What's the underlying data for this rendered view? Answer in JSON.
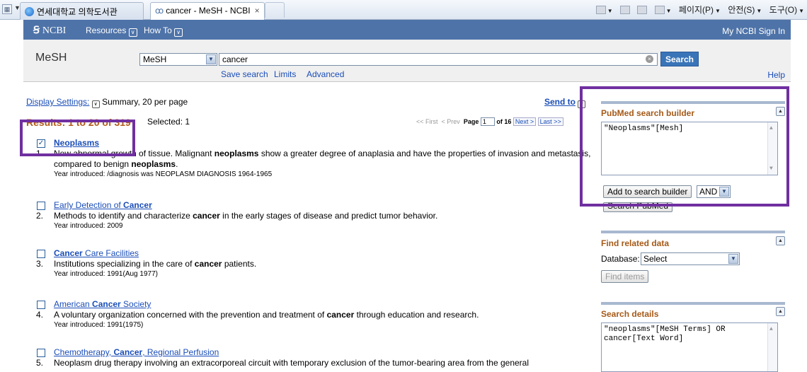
{
  "browser": {
    "tabs": [
      {
        "label": "연세대학교 의학도서관"
      },
      {
        "label": "cancer - MeSH - NCBI",
        "close": "×"
      }
    ],
    "commands": [
      "페이지(P)",
      "안전(S)",
      "도구(O)"
    ]
  },
  "ncbi": {
    "logo": "NCBI",
    "nav": [
      "Resources",
      "How To"
    ],
    "user_links": "My NCBI  Sign In"
  },
  "search": {
    "db_title": "MeSH",
    "db_select": "MeSH",
    "query": "cancer",
    "button": "Search",
    "links": [
      "Save search",
      "Limits",
      "Advanced"
    ],
    "help": "Help"
  },
  "results": {
    "display_settings_label": "Display Settings:",
    "display_settings_value": "Summary, 20 per page",
    "send_to": "Send to",
    "count_text": "Results: 1 to 20 of 319",
    "selected": "Selected: 1",
    "pager": {
      "first": "<< First",
      "prev": "< Prev",
      "page_label": "Page",
      "page": "1",
      "of": "of 16",
      "next": "Next >",
      "last": "Last >>"
    },
    "items": [
      {
        "checked": true,
        "number": "1.",
        "title_parts": [
          {
            "t": "Neoplasms",
            "b": true
          }
        ],
        "desc_parts": [
          {
            "t": "New abnormal growth of tissue. Malignant "
          },
          {
            "t": "neoplasms",
            "b": true
          },
          {
            "t": " show a greater degree of anaplasia and have the properties of invasion and metastasis, compared to benign "
          },
          {
            "t": "neoplasms",
            "b": true
          },
          {
            "t": "."
          }
        ],
        "year": "Year introduced: /diagnosis was NEOPLASM DIAGNOSIS 1964-1965"
      },
      {
        "checked": false,
        "number": "2.",
        "title_parts": [
          {
            "t": "Early Detection of "
          },
          {
            "t": "Cancer",
            "b": true
          }
        ],
        "desc_parts": [
          {
            "t": "Methods to identify and characterize "
          },
          {
            "t": "cancer",
            "b": true
          },
          {
            "t": " in the early stages of disease and predict tumor behavior."
          }
        ],
        "year": "Year introduced: 2009"
      },
      {
        "checked": false,
        "number": "3.",
        "title_parts": [
          {
            "t": "Cancer",
            "b": true
          },
          {
            "t": " Care Facilities"
          }
        ],
        "desc_parts": [
          {
            "t": "Institutions specializing in the care of "
          },
          {
            "t": "cancer",
            "b": true
          },
          {
            "t": " patients."
          }
        ],
        "year": "Year introduced: 1991(Aug 1977)"
      },
      {
        "checked": false,
        "number": "4.",
        "title_parts": [
          {
            "t": "American "
          },
          {
            "t": "Cancer",
            "b": true
          },
          {
            "t": " Society"
          }
        ],
        "desc_parts": [
          {
            "t": "A voluntary organization concerned with the prevention and treatment of "
          },
          {
            "t": "cancer",
            "b": true
          },
          {
            "t": " through education and research."
          }
        ],
        "year": "Year introduced: 1991(1975)"
      },
      {
        "checked": false,
        "number": "5.",
        "title_parts": [
          {
            "t": "Chemotherapy, "
          },
          {
            "t": "Cancer",
            "b": true
          },
          {
            "t": ", Regional Perfusion"
          }
        ],
        "desc_parts": [
          {
            "t": "Neoplasm drug therapy involving an extracorporeal circuit with temporary exclusion of the tumor-bearing area from the general"
          }
        ],
        "year": ""
      }
    ]
  },
  "sidebar": {
    "builder": {
      "title": "PubMed search builder",
      "text": "\"Neoplasms\"[Mesh]",
      "add_button": "Add to search builder",
      "operator": "AND",
      "search_pubmed": "Search PubMed"
    },
    "related": {
      "title": "Find related data",
      "db_label": "Database:",
      "db_value": "Select",
      "button": "Find items"
    },
    "details": {
      "title": "Search details",
      "text": "\"neoplasms\"[MeSH Terms] OR cancer[Text Word]"
    }
  },
  "colors": {
    "annotation": "#7030a0",
    "ncbi_bar": "#4e73a8",
    "link": "#1a4db8",
    "results_count": "#b05a1a"
  }
}
